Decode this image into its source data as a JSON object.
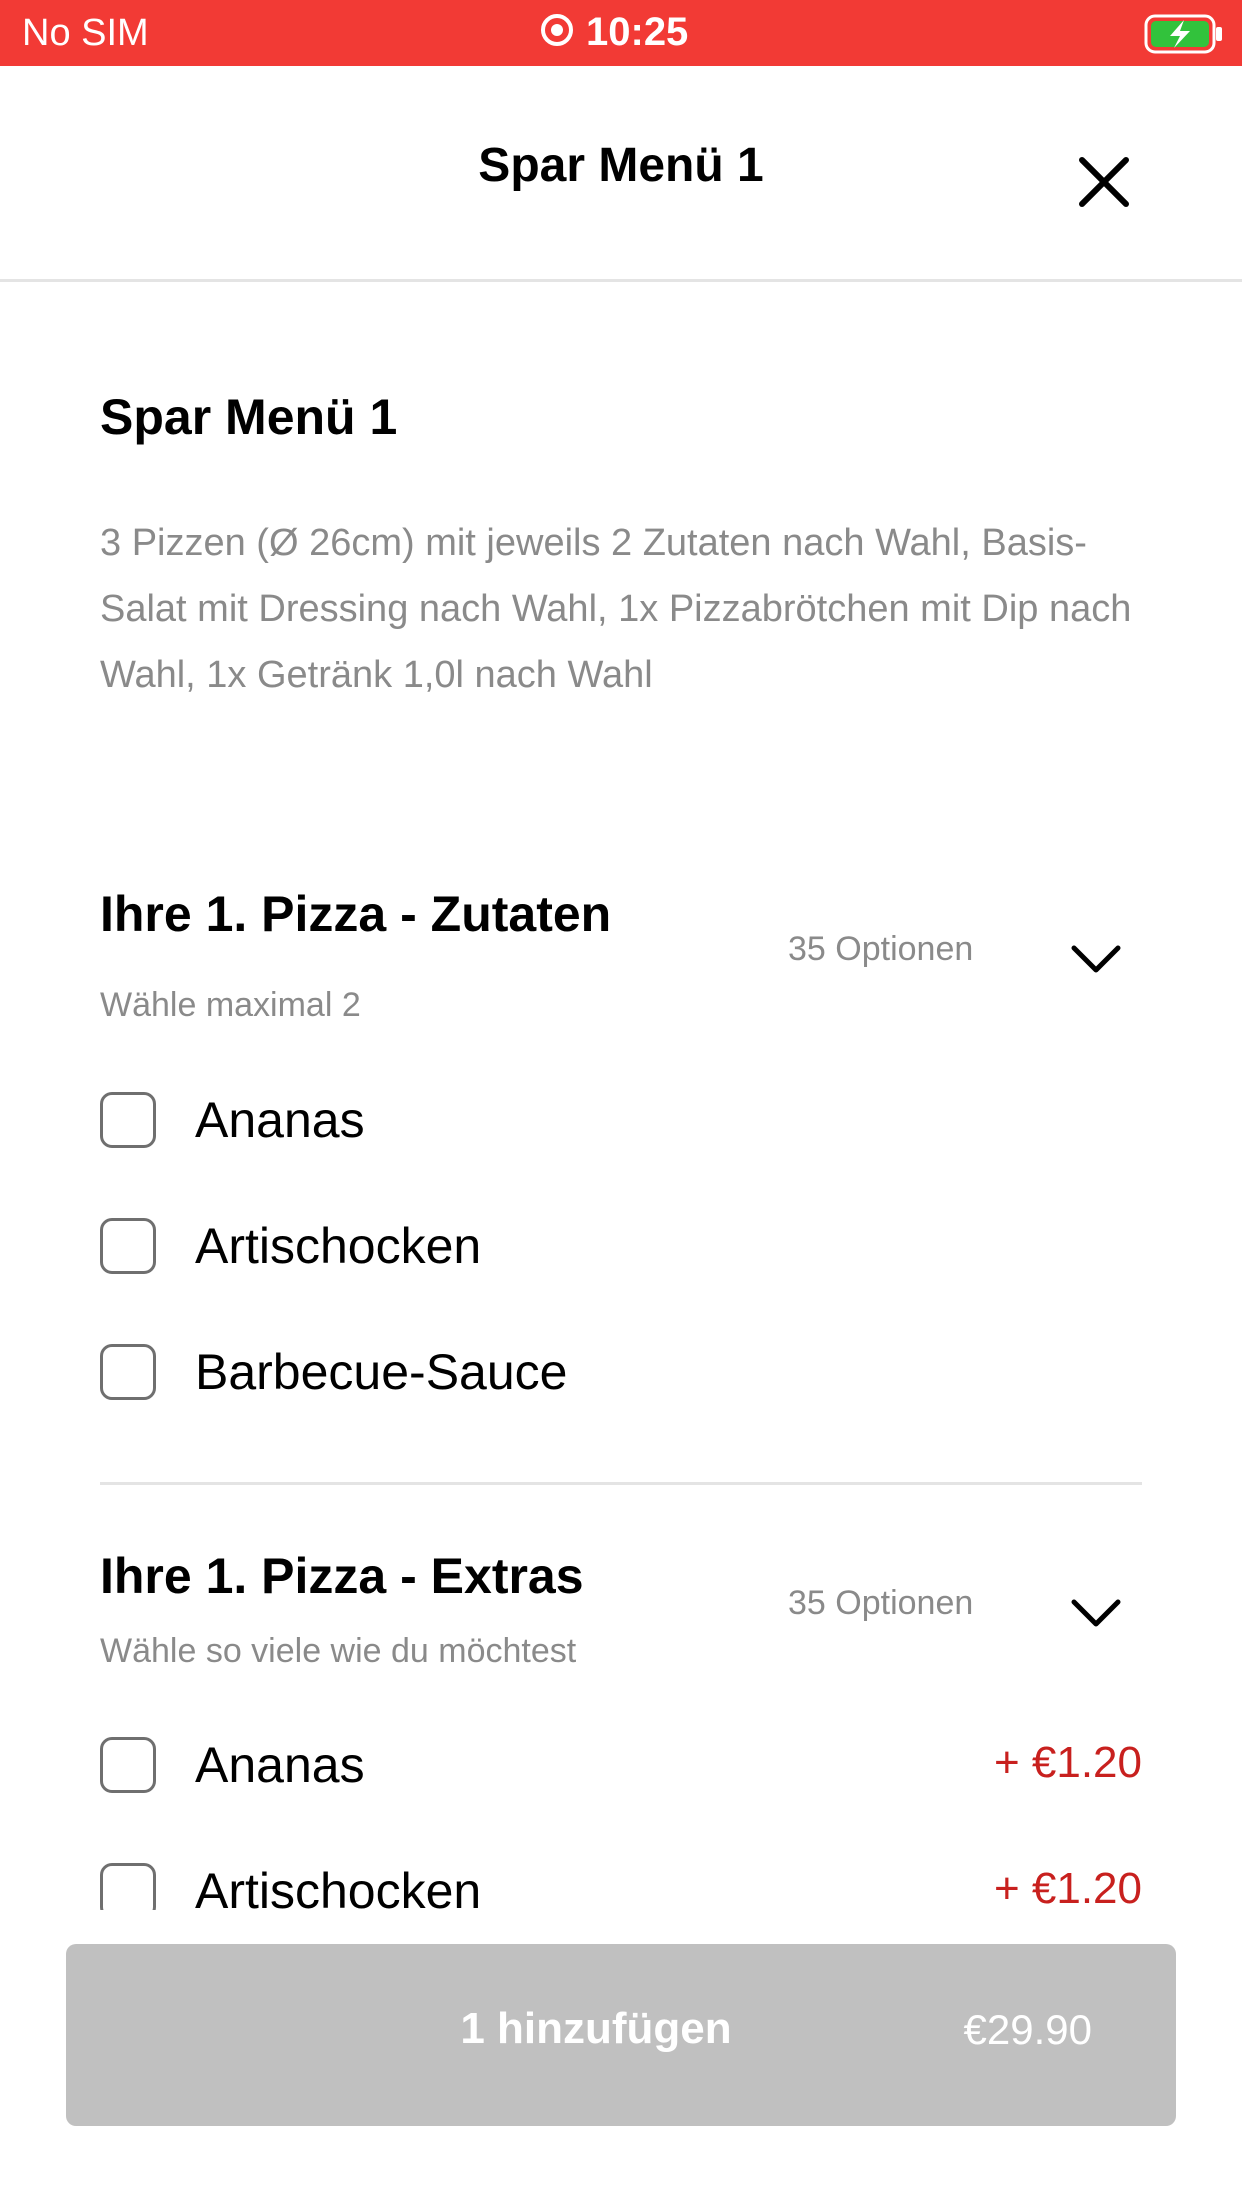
{
  "status_bar": {
    "carrier": "No SIM",
    "time": "10:25",
    "background_color": "#f23a35",
    "battery_icon": "battery-charging-icon",
    "center_icon": "location-target-icon"
  },
  "nav": {
    "title": "Spar Menü 1",
    "close_icon": "close-icon"
  },
  "item": {
    "title": "Spar Menü 1",
    "description": "3 Pizzen (Ø 26cm) mit jeweils 2 Zutaten nach Wahl, Basis-Salat mit Dressing nach Wahl, 1x Pizzabrötchen mit Dip nach Wahl, 1x Getränk 1,0l nach Wahl"
  },
  "sections": [
    {
      "title": "Ihre 1. Pizza - Zutaten",
      "subtitle": "Wähle maximal 2",
      "count": "35 Optionen",
      "expand_icon": "chevron-down-icon",
      "options": [
        {
          "label": "Ananas",
          "checked": false
        },
        {
          "label": "Artischocken",
          "checked": false
        },
        {
          "label": "Barbecue-Sauce",
          "checked": false
        }
      ]
    },
    {
      "title": "Ihre 1. Pizza - Extras",
      "subtitle": "Wähle so viele wie du möchtest",
      "count": "35 Optionen",
      "expand_icon": "chevron-down-icon",
      "options": [
        {
          "label": "Ananas",
          "price": "+ €1.20",
          "checked": false
        },
        {
          "label": "Artischocken",
          "price": "+ €1.20",
          "checked": false
        }
      ]
    }
  ],
  "cta": {
    "label": "1 hinzufügen",
    "price": "€29.90",
    "disabled": true,
    "background_color": "#c0c0c0"
  },
  "colors": {
    "accent": "#f23a35",
    "price": "#c8201e",
    "muted_text": "#8a8a8a"
  }
}
